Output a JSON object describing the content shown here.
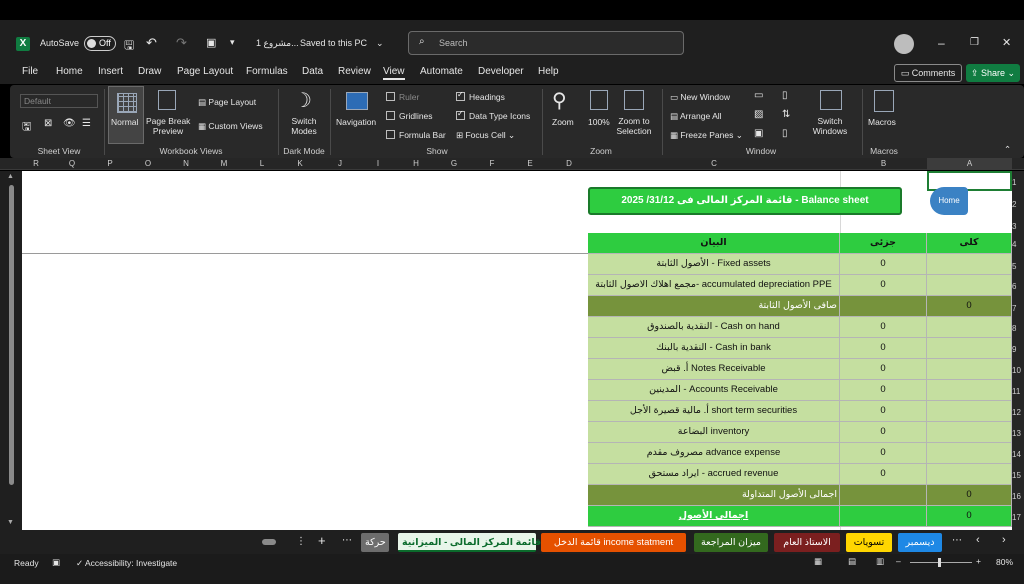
{
  "titlebar": {
    "autosave_label": "AutoSave",
    "autosave_state": "Off",
    "file_name": "مشروع 1...",
    "save_status": "Saved to this PC",
    "search_placeholder": "Search"
  },
  "menu": [
    "File",
    "Home",
    "Insert",
    "Draw",
    "Page Layout",
    "Formulas",
    "Data",
    "Review",
    "View",
    "Automate",
    "Developer",
    "Help"
  ],
  "menu_active": "View",
  "actions": {
    "comments": "Comments",
    "share": "Share"
  },
  "ribbon": {
    "sheet_view_dropdown": "Default",
    "normal": "Normal",
    "page_break_preview_1": "Page Break",
    "page_break_preview_2": "Preview",
    "page_layout": "Page Layout",
    "custom_views": "Custom Views",
    "switch_modes_1": "Switch",
    "switch_modes_2": "Modes",
    "navigation": "Navigation",
    "ruler": "Ruler",
    "gridlines": "Gridlines",
    "formula_bar": "Formula Bar",
    "headings": "Headings",
    "data_type_icons": "Data Type Icons",
    "focus_cell": "Focus Cell",
    "zoom": "Zoom",
    "zoom_100": "100%",
    "zoom_to_selection_1": "Zoom to",
    "zoom_to_selection_2": "Selection",
    "new_window": "New Window",
    "arrange_all": "Arrange All",
    "freeze_panes": "Freeze Panes",
    "switch_windows_1": "Switch",
    "switch_windows_2": "Windows",
    "macros": "Macros",
    "groups": {
      "sheet_view": "Sheet View",
      "workbook_views": "Workbook Views",
      "dark_mode": "Dark Mode",
      "show": "Show",
      "zoom": "Zoom",
      "window": "Window",
      "macros": "Macros"
    }
  },
  "columns": [
    "R",
    "Q",
    "P",
    "O",
    "N",
    "M",
    "L",
    "K",
    "J",
    "I",
    "H",
    "G",
    "F",
    "E",
    "D",
    "C",
    "B",
    "A"
  ],
  "row_numbers": [
    "1",
    "2",
    "3",
    "4",
    "5",
    "6",
    "7",
    "8",
    "9",
    "10",
    "11",
    "12",
    "13",
    "14",
    "15",
    "16",
    "17",
    "18"
  ],
  "sheet": {
    "title": "قائمة المركز المالى فى 31/12/ 2025 - Balance sheet",
    "home_button": "Home",
    "headers": {
      "description": "البيان",
      "partial": "جزئى",
      "total": "كلى"
    },
    "rows": [
      {
        "label": "الأصول الثابتة - Fixed assets",
        "partial": "0",
        "total": "",
        "kind": "item"
      },
      {
        "label": "مجمع اهلاك الاصول الثابتة- accumulated depreciation PPE",
        "partial": "0",
        "total": "",
        "kind": "item"
      },
      {
        "label": "صافى الأصول الثابتة",
        "partial": "",
        "total": "0",
        "kind": "subtotal"
      },
      {
        "label": "النقدية بالصندوق - Cash on hand",
        "partial": "0",
        "total": "",
        "kind": "item"
      },
      {
        "label": "النقدية بالبنك - Cash in bank",
        "partial": "0",
        "total": "",
        "kind": "item"
      },
      {
        "label": "أ. قبض Notes Receivable",
        "partial": "0",
        "total": "",
        "kind": "item"
      },
      {
        "label": "المدينين - Accounts Receivable",
        "partial": "0",
        "total": "",
        "kind": "item"
      },
      {
        "label": "أ. مالية قصيرة الأجل short term securities",
        "partial": "0",
        "total": "",
        "kind": "item"
      },
      {
        "label": "البضاعة inventory",
        "partial": "0",
        "total": "",
        "kind": "item"
      },
      {
        "label": "مصروف مقدم advance expense",
        "partial": "0",
        "total": "",
        "kind": "item"
      },
      {
        "label": "ايراد مستحق - accrued revenue",
        "partial": "0",
        "total": "",
        "kind": "item"
      },
      {
        "label": "اجمالى الأصول المتداولة",
        "partial": "",
        "total": "0",
        "kind": "subtotal"
      },
      {
        "label": "اجمالى الأصول",
        "partial": "",
        "total": "0",
        "kind": "grand"
      }
    ]
  },
  "tabs": [
    {
      "label": "ديسمبر",
      "bg": "#1e88e5",
      "fg": "#ffffff"
    },
    {
      "label": "تسويات",
      "bg": "#ffd600",
      "fg": "#000000"
    },
    {
      "label": "الاستاذ العام",
      "bg": "#7b1f1f",
      "fg": "#ffffff"
    },
    {
      "label": "ميزان المراجعة",
      "bg": "#33691e",
      "fg": "#ffffff"
    },
    {
      "label": "قائمة الدخل income statment",
      "bg": "#e65100",
      "fg": "#ffffff"
    },
    {
      "label": "قائمة المركز المالى - الميزانية",
      "bg": "#e8f5e9",
      "fg": "#0b6b2c"
    },
    {
      "label": "حركة",
      "bg": "#6d6d6d",
      "fg": "#ffffff"
    }
  ],
  "status": {
    "ready": "Ready",
    "accessibility": "Accessibility: Investigate",
    "zoom": "80%"
  },
  "colors": {
    "header_green": "#2ecc40",
    "row_light": "#c5dfa0",
    "row_dark": "#76933c",
    "title_green": "#2ecc40"
  }
}
